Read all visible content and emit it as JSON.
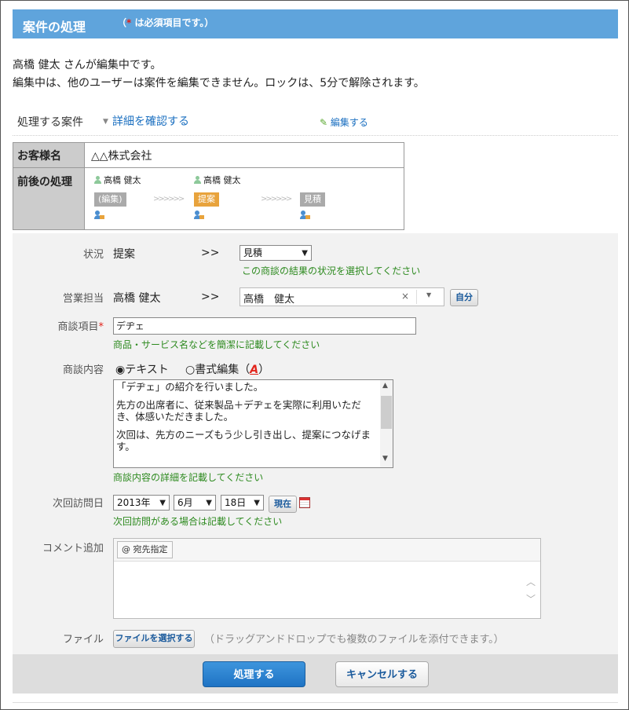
{
  "header": {
    "title": "案件の処理",
    "required_star": "*",
    "required_note": "は必須項目です。）",
    "required_open": "（"
  },
  "lock_notice": {
    "line1": "高橋 健太 さんが編集中です。",
    "line2": "編集中は、他のユーザーは案件を編集できません。ロックは、5分で解除されます。"
  },
  "case_section": {
    "label": "処理する案件",
    "detail_link": "詳細を確認する",
    "edit_link": "編集する"
  },
  "info_table": {
    "customer_label": "お客様名",
    "customer_value": "△△株式会社",
    "flow_label": "前後の処理",
    "flow": [
      {
        "person": "高橋 健太",
        "status": "(編集)"
      },
      {
        "person": "高橋 健太",
        "status": "提案"
      },
      {
        "person": "",
        "status": "見積"
      }
    ],
    "arrows": ">>>>>>"
  },
  "form": {
    "status": {
      "label": "状況",
      "current": "提案",
      "arrow": ">>",
      "selected": "見積",
      "hint": "この商談の結果の状況を選択してください"
    },
    "sales": {
      "label": "営業担当",
      "current": "高橋 健太",
      "arrow": ">>",
      "selected": "高橋　健太",
      "self_button": "自分"
    },
    "item": {
      "label": "商談項目",
      "star": "*",
      "value": "デヂェ",
      "hint": "商品・サービス名などを簡潔に記載してください"
    },
    "content": {
      "label": "商談内容",
      "radio_text": "◉テキスト",
      "radio_rich": "○書式編集（",
      "radio_rich_close": "）",
      "rich_icon": "A",
      "paragraphs": [
        "「デヂェ」の紹介を行いました。",
        "先方の出席者に、従来製品＋デヂェを実際に利用いただき、体感いただきました。",
        "次回は、先方のニーズもう少し引き出し、提案につなげます。"
      ],
      "hint": "商談内容の詳細を記載してください"
    },
    "next_visit": {
      "label": "次回訪問日",
      "year": "2013年",
      "month": "6月",
      "day": "18日",
      "now_button": "現在",
      "hint": "次回訪問がある場合は記載してください"
    },
    "comment": {
      "label": "コメント追加",
      "mention_button": "@ 宛先指定"
    },
    "file": {
      "label": "ファイル",
      "button": "ファイルを選択する",
      "note": "（ドラッグアンドドロップでも複数のファイルを添付できます。）"
    }
  },
  "footer": {
    "submit": "処理する",
    "cancel": "キャンセルする"
  }
}
